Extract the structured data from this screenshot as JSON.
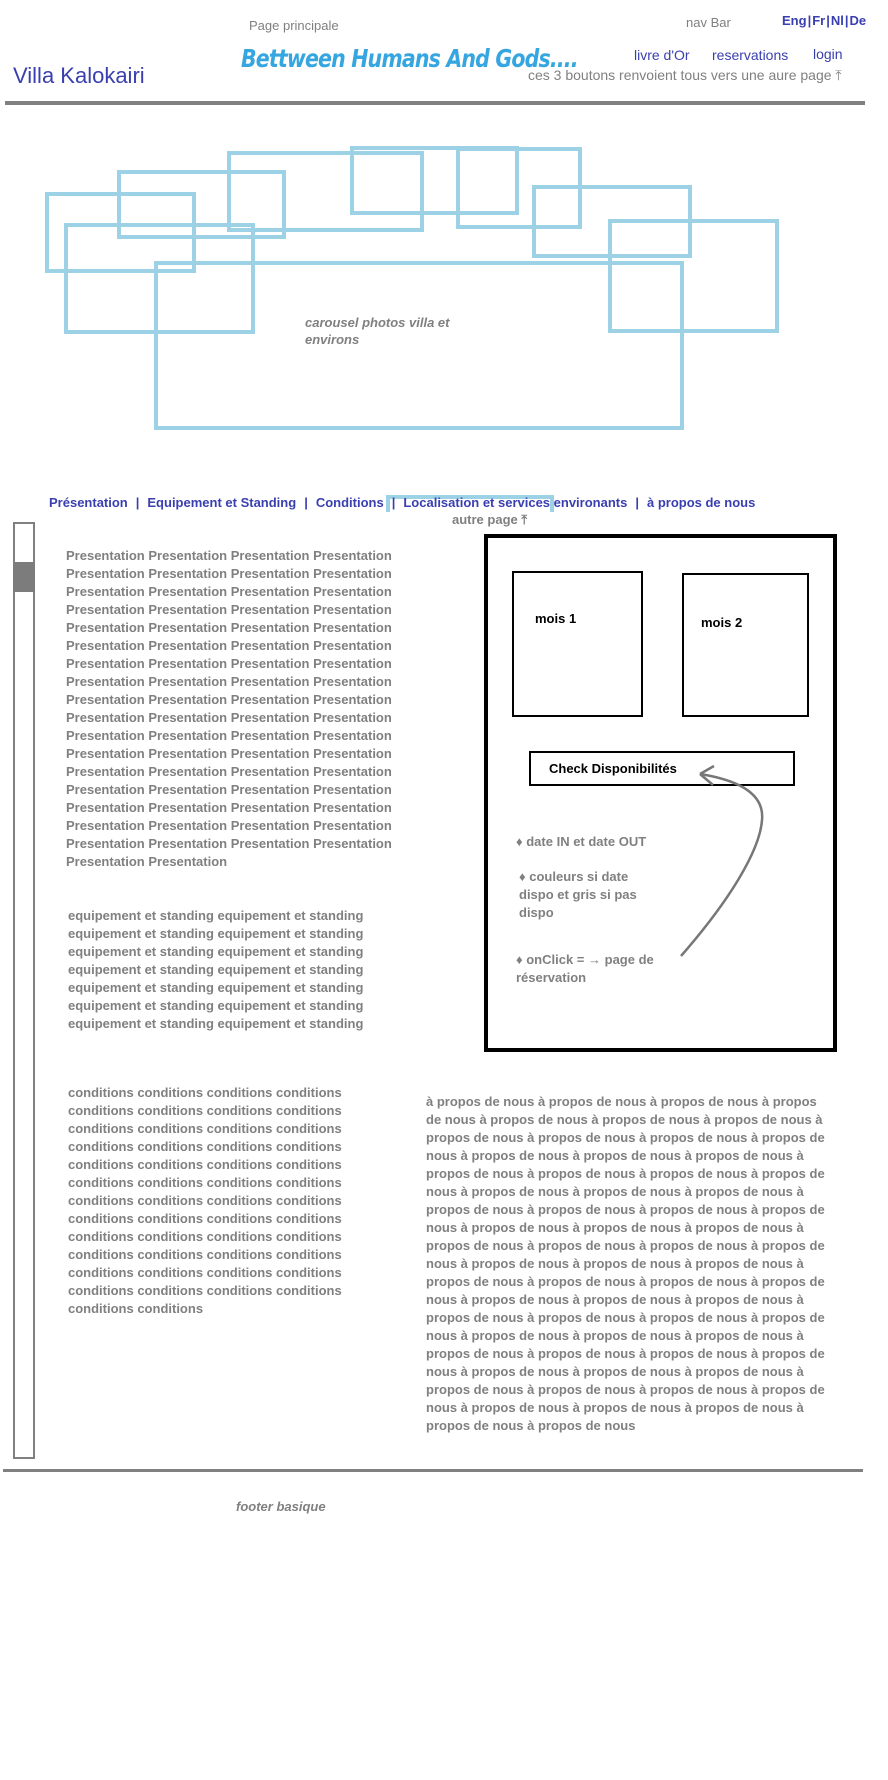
{
  "header": {
    "page_principale": "Page principale",
    "nav_bar_label": "nav Bar",
    "languages": [
      "Eng",
      "Fr",
      "Nl",
      "De"
    ],
    "site_title": "Villa Kalokairi",
    "tagline": "Bettween Humans And Gods....",
    "nav_links": [
      "livre d'Or",
      "reservations",
      "login"
    ],
    "nav_note": "ces 3 boutons renvoient tous vers une aure page ⤒"
  },
  "carousel": {
    "caption": "carousel photos villa et environs",
    "frame_color": "#9dd2e6"
  },
  "section_nav": {
    "items": [
      "Présentation",
      "Equipement  et Standing",
      "Conditions",
      "Localisation et services environants",
      "à propos de nous"
    ],
    "separator": "|",
    "note": "autre page ⤒"
  },
  "content": {
    "presentation": "Presentation Presentation Presentation Presentation Presentation Presentation Presentation Presentation Presentation Presentation Presentation Presentation Presentation Presentation Presentation Presentation Presentation Presentation Presentation Presentation Presentation Presentation Presentation Presentation Presentation Presentation Presentation Presentation Presentation Presentation Presentation Presentation Presentation Presentation Presentation Presentation Presentation Presentation Presentation Presentation Presentation Presentation Presentation Presentation Presentation Presentation Presentation Presentation Presentation Presentation Presentation Presentation Presentation Presentation Presentation Presentation Presentation Presentation Presentation Presentation Presentation Presentation Presentation Presentation Presentation Presentation Presentation Presentation Presentation Presentation",
    "equipement": "equipement et standing equipement et standing equipement et standing equipement et standing equipement et standing equipement et standing equipement et standing equipement et standing equipement et standing equipement et standing equipement et standing equipement et standing equipement et standing equipement et standing",
    "conditions": "conditions conditions conditions conditions conditions conditions conditions conditions conditions conditions conditions conditions conditions conditions conditions conditions conditions conditions conditions conditions conditions conditions conditions conditions conditions conditions conditions conditions conditions conditions conditions conditions conditions conditions conditions conditions conditions conditions conditions conditions conditions conditions conditions conditions conditions conditions conditions conditions conditions conditions",
    "a_propos": "à propos de nous à propos de nous à propos de nous à propos de nous à propos de nous à propos de nous à propos de nous à propos de nous à propos de nous à propos de nous à propos de nous à propos de nous à propos de nous à propos de nous à propos de nous à propos de nous à propos de nous à propos de nous à propos de nous à propos de nous à propos de nous à propos de nous à propos de nous à propos de nous à propos de nous à propos de nous à propos de nous à propos de nous à propos de nous à propos de nous à propos de nous à propos de nous à propos de nous à propos de nous à propos de nous à propos de nous à propos de nous à propos de nous à propos de nous à propos de nous à propos de nous à propos de nous à propos de nous à propos de nous à propos de nous à propos de nous à propos de nous à propos de nous à propos de nous à propos de nous à propos de nous à propos de nous à propos de nous à propos de nous à propos de nous à propos de nous à propos de nous à propos de nous à propos de nous à propos de nous à propos de nous à propos de nous à propos de nous à propos de nous à propos de nous"
  },
  "booking": {
    "month_1": "mois 1",
    "month_2": "mois 2",
    "check_button": "Check Disponibilités",
    "note_dates": "♦ date IN et date OUT",
    "note_colors": "♦ couleurs si date dispo et gris si pas dispo",
    "note_onclick": "♦ onClick = → page de réservation"
  },
  "footer": {
    "label": "footer basique"
  }
}
